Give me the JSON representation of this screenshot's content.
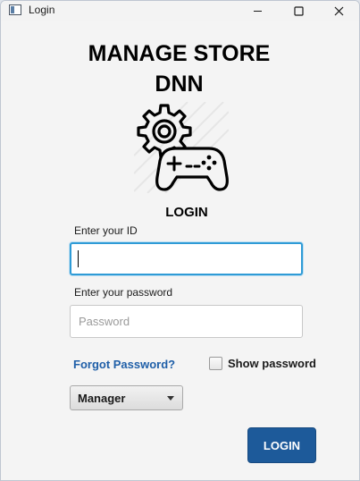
{
  "window": {
    "title": "Login",
    "controls": [
      "minimize",
      "maximize",
      "close"
    ]
  },
  "header": {
    "title_line1": "MANAGE STORE",
    "title_line2": "DNN"
  },
  "logo": {
    "icon": "gear-gamepad-icon"
  },
  "form": {
    "heading": "LOGIN",
    "id_label": "Enter your ID",
    "id_value": "",
    "password_label": "Enter your password",
    "password_placeholder": "Password",
    "password_value": "",
    "forgot_link": "Forgot Password?",
    "show_password_label": "Show password",
    "show_password_checked": false,
    "role_selected": "Manager",
    "login_button": "LOGIN"
  },
  "colors": {
    "link": "#1f5fa8",
    "button": "#1d5a9a",
    "focus_border": "#2f9bd6"
  }
}
